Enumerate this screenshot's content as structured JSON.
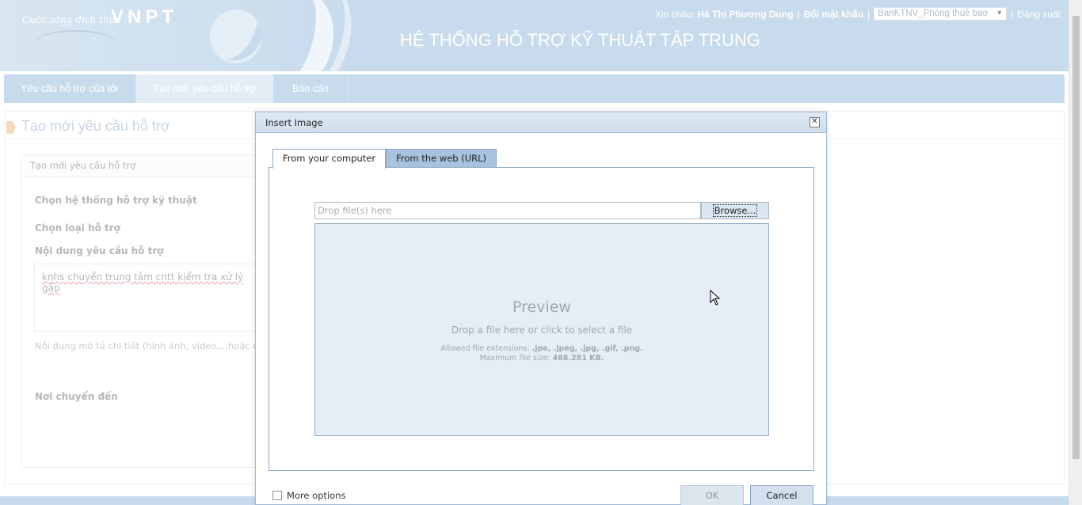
{
  "header": {
    "slogan": "Cuộc sống đích thực",
    "brand": "VNPT",
    "system_title": "HỆ THỐNG HỖ TRỢ KỸ THUẬT TẬP TRUNG",
    "greeting_label": "Xin chào:",
    "user_name": "Hà Thị Phương Dung",
    "separator": "|",
    "change_password": "Đổi mật khẩu",
    "department_selected": "BanKTNV_Phòng thuê bao",
    "logout": "Đăng xuất"
  },
  "nav": {
    "tabs": [
      {
        "label": "Yêu cầu hỗ trợ của tôi"
      },
      {
        "label": "Tạo mới yêu cầu hỗ trợ"
      },
      {
        "label": "Báo cáo"
      }
    ]
  },
  "page": {
    "title": "Tạo mới yêu cầu hỗ trợ",
    "form_header": "Tạo mới yêu cầu hỗ trợ",
    "label_system": "Chọn hệ thống hỗ trợ kỹ thuật",
    "label_type": "Chọn loại hỗ trợ",
    "label_content": "Nội dung yêu cầu hỗ trợ",
    "content_value": "knhs chuyển trung tâm cntt kiểm tra xử lý gấp",
    "hint": "Nội dung mô tả chi tiết (hình ảnh, video,...hoặc đa",
    "label_destination": "Nơi chuyển đến"
  },
  "dialog": {
    "title": "Insert Image",
    "tabs": [
      {
        "label": "From your computer",
        "active": true
      },
      {
        "label": "From the web (URL)",
        "active": false
      }
    ],
    "drop_placeholder": "Drop file(s) here",
    "browse_label": "Browse...",
    "preview_title": "Preview",
    "preview_subtitle": "Drop a file here or click to select a file",
    "allowed_label": "Allowed file extensions:",
    "allowed_extensions": ".jpe, .jpeg, .jpg, .gif, .png.",
    "max_size_label": "Maximum file size:",
    "max_size_value": "488.281 KB.",
    "more_options_label": "More options",
    "ok_label": "OK",
    "cancel_label": "Cancel"
  },
  "colors": {
    "header_bg": "#aac8e2",
    "active_tab_bg": "#d6e4f0",
    "preview_bg": "#e6edf7",
    "web_tab_bg": "#a7c1de"
  }
}
